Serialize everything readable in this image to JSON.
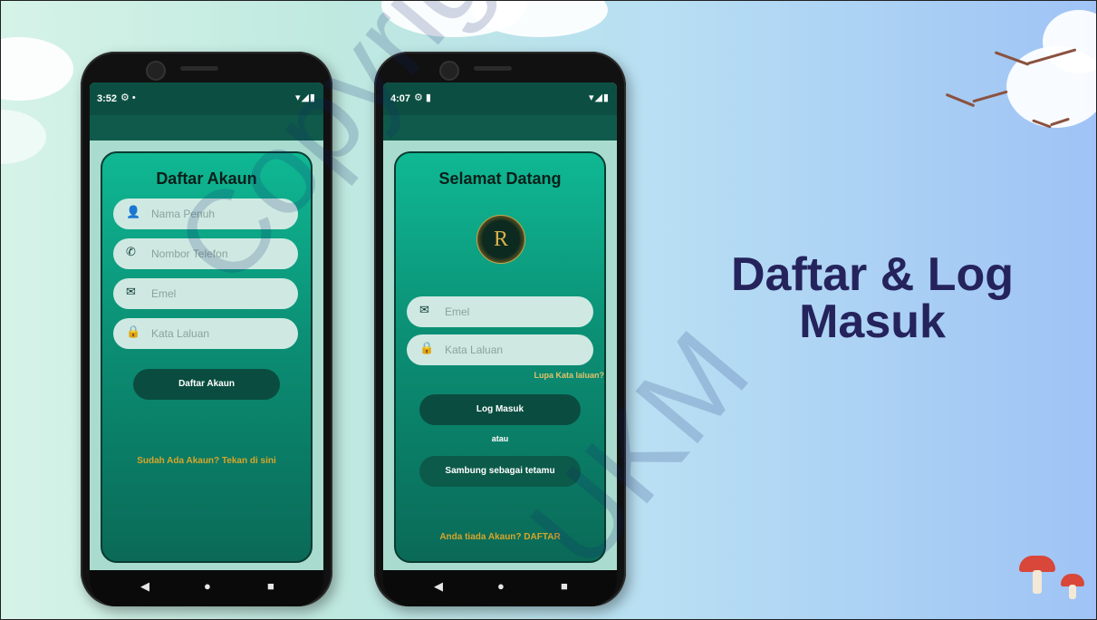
{
  "colors": {
    "accent": "#0fb893",
    "dark_green": "#0a4d40",
    "gold": "#d8a52a",
    "headline": "#25235c"
  },
  "slide": {
    "headline_line1": "Daftar & Log",
    "headline_line2": "Masuk",
    "watermark_line1": "Copyright@FTSM",
    "watermark_line2": "UKM"
  },
  "phone1": {
    "status_time": "3:52",
    "card_title": "Daftar Akaun",
    "fields": [
      {
        "icon": "person-icon",
        "placeholder": "Nama Penuh"
      },
      {
        "icon": "phone-icon",
        "placeholder": "Nombor Telefon"
      },
      {
        "icon": "mail-icon",
        "placeholder": "Emel"
      },
      {
        "icon": "lock-icon",
        "placeholder": "Kata Laluan"
      }
    ],
    "register_button": "Daftar Akaun",
    "login_link": "Sudah Ada Akaun? Tekan di sini"
  },
  "phone2": {
    "status_time": "4:07",
    "card_title": "Selamat Datang",
    "logo_text": "R",
    "fields": [
      {
        "icon": "mail-icon",
        "placeholder": "Emel"
      },
      {
        "icon": "lock-icon",
        "placeholder": "Kata Laluan"
      }
    ],
    "forgot_link": "Lupa Kata laluan?",
    "login_button": "Log Masuk",
    "or_text": "atau",
    "guest_button": "Sambung sebagai tetamu",
    "signup_link": "Anda tiada Akaun? DAFTAR"
  },
  "navbar": {
    "back": "◀",
    "home": "●",
    "recents": "■"
  }
}
